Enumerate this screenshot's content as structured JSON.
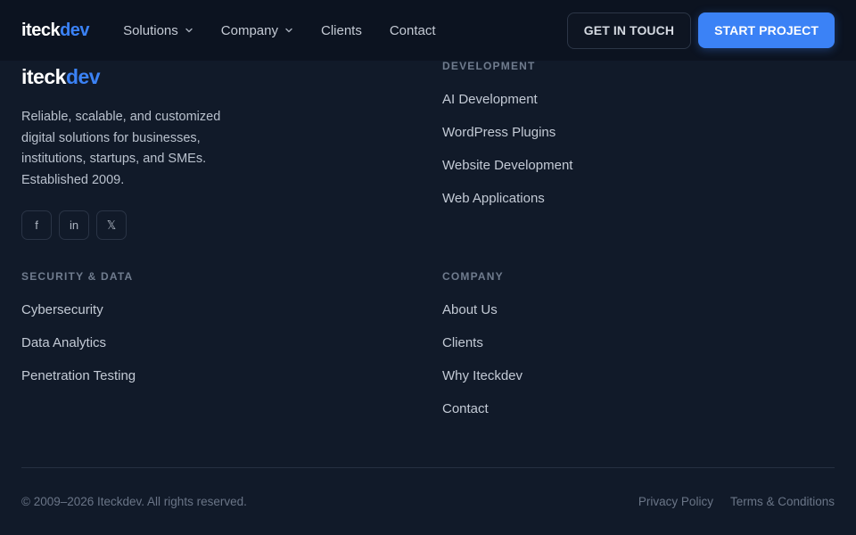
{
  "header": {
    "logo": {
      "main": "iteck",
      "accent": "dev"
    },
    "nav": [
      {
        "label": "Solutions",
        "has_dropdown": true
      },
      {
        "label": "Company",
        "has_dropdown": true
      },
      {
        "label": "Clients",
        "has_dropdown": false
      },
      {
        "label": "Contact",
        "has_dropdown": false
      }
    ],
    "get_in_touch": "GET IN TOUCH",
    "start_project": "START PROJECT"
  },
  "footer": {
    "logo": {
      "main": "iteck",
      "accent": "dev"
    },
    "tagline": "Reliable, scalable, and customized digital solutions for businesses, institutions, startups, and SMEs. Established 2009.",
    "socials": [
      {
        "icon": "facebook-icon",
        "glyph": "f"
      },
      {
        "icon": "linkedin-icon",
        "glyph": "in"
      },
      {
        "icon": "x-icon",
        "glyph": "𝕏"
      }
    ],
    "columns": {
      "development": {
        "heading": "DEVELOPMENT",
        "links": [
          "AI Development",
          "WordPress Plugins",
          "Website Development",
          "Web Applications"
        ]
      },
      "security": {
        "heading": "SECURITY & DATA",
        "links": [
          "Cybersecurity",
          "Data Analytics",
          "Penetration Testing"
        ]
      },
      "company": {
        "heading": "COMPANY",
        "links": [
          "About Us",
          "Clients",
          "Why Iteckdev",
          "Contact"
        ]
      }
    },
    "copyright": "© 2009–2026 Iteckdev. All rights reserved.",
    "legal": [
      "Privacy Policy",
      "Terms & Conditions"
    ]
  },
  "colors": {
    "background": "#111a29",
    "header_bg": "#0c1320",
    "accent": "#3b82f6"
  }
}
